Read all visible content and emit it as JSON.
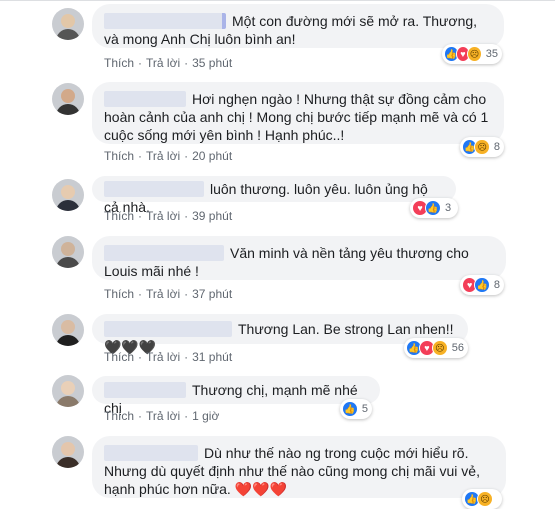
{
  "labels": {
    "like": "Thích",
    "reply": "Trả lời",
    "sep": "·"
  },
  "comments": [
    {
      "text": "Một con đường mới sẽ mở ra. Thương, và mong Anh Chị luôn bình an!",
      "time": "35 phút",
      "reaction_count": "35",
      "reactions": [
        "like-icon",
        "love-icon",
        "sad-icon"
      ]
    },
    {
      "text": "Hơi nghẹn ngào ! Nhưng thật sự đồng cảm cho hoàn cảnh của anh chị ! Mong chị bước tiếp mạnh mẽ và có 1 cuộc sống mới yên bình ! Hạnh phúc..!",
      "time": "20 phút",
      "reaction_count": "8",
      "reactions": [
        "like-icon",
        "sad-icon"
      ]
    },
    {
      "text": "luôn thương. luôn yêu. luôn ủng hộ cả nhà.",
      "time": "39 phút",
      "reaction_count": "3",
      "reactions": [
        "love-icon",
        "like-icon"
      ]
    },
    {
      "text": "Văn minh và nền tảng yêu thương cho Louis mãi nhé !",
      "time": "37 phút",
      "reaction_count": "8",
      "reactions": [
        "love-icon",
        "like-icon"
      ]
    },
    {
      "text": "Thương Lan. Be strong Lan nhen!! 🖤🖤🖤",
      "time": "31 phút",
      "reaction_count": "56",
      "reactions": [
        "like-icon",
        "love-icon",
        "sad-icon"
      ]
    },
    {
      "text": "Thương chị, mạnh mẽ nhé chị",
      "time": "1 giờ",
      "reaction_count": "5",
      "reactions": [
        "like-icon"
      ]
    },
    {
      "text": "Dù như thế nào ng trong cuộc mới hiểu rõ. Nhưng dù quyết định như thế nào cũng mong chị mãi vui vẻ, hạnh phúc hơn nữa. ❤️❤️❤️",
      "time": "",
      "reaction_count": "",
      "reactions": [
        "like-icon",
        "sad-icon"
      ]
    }
  ],
  "colors": {
    "like": "#2078f4",
    "love": "#f33e58",
    "sad": "#f7b125",
    "bubble": "#f2f3f5",
    "meta": "#606770"
  }
}
